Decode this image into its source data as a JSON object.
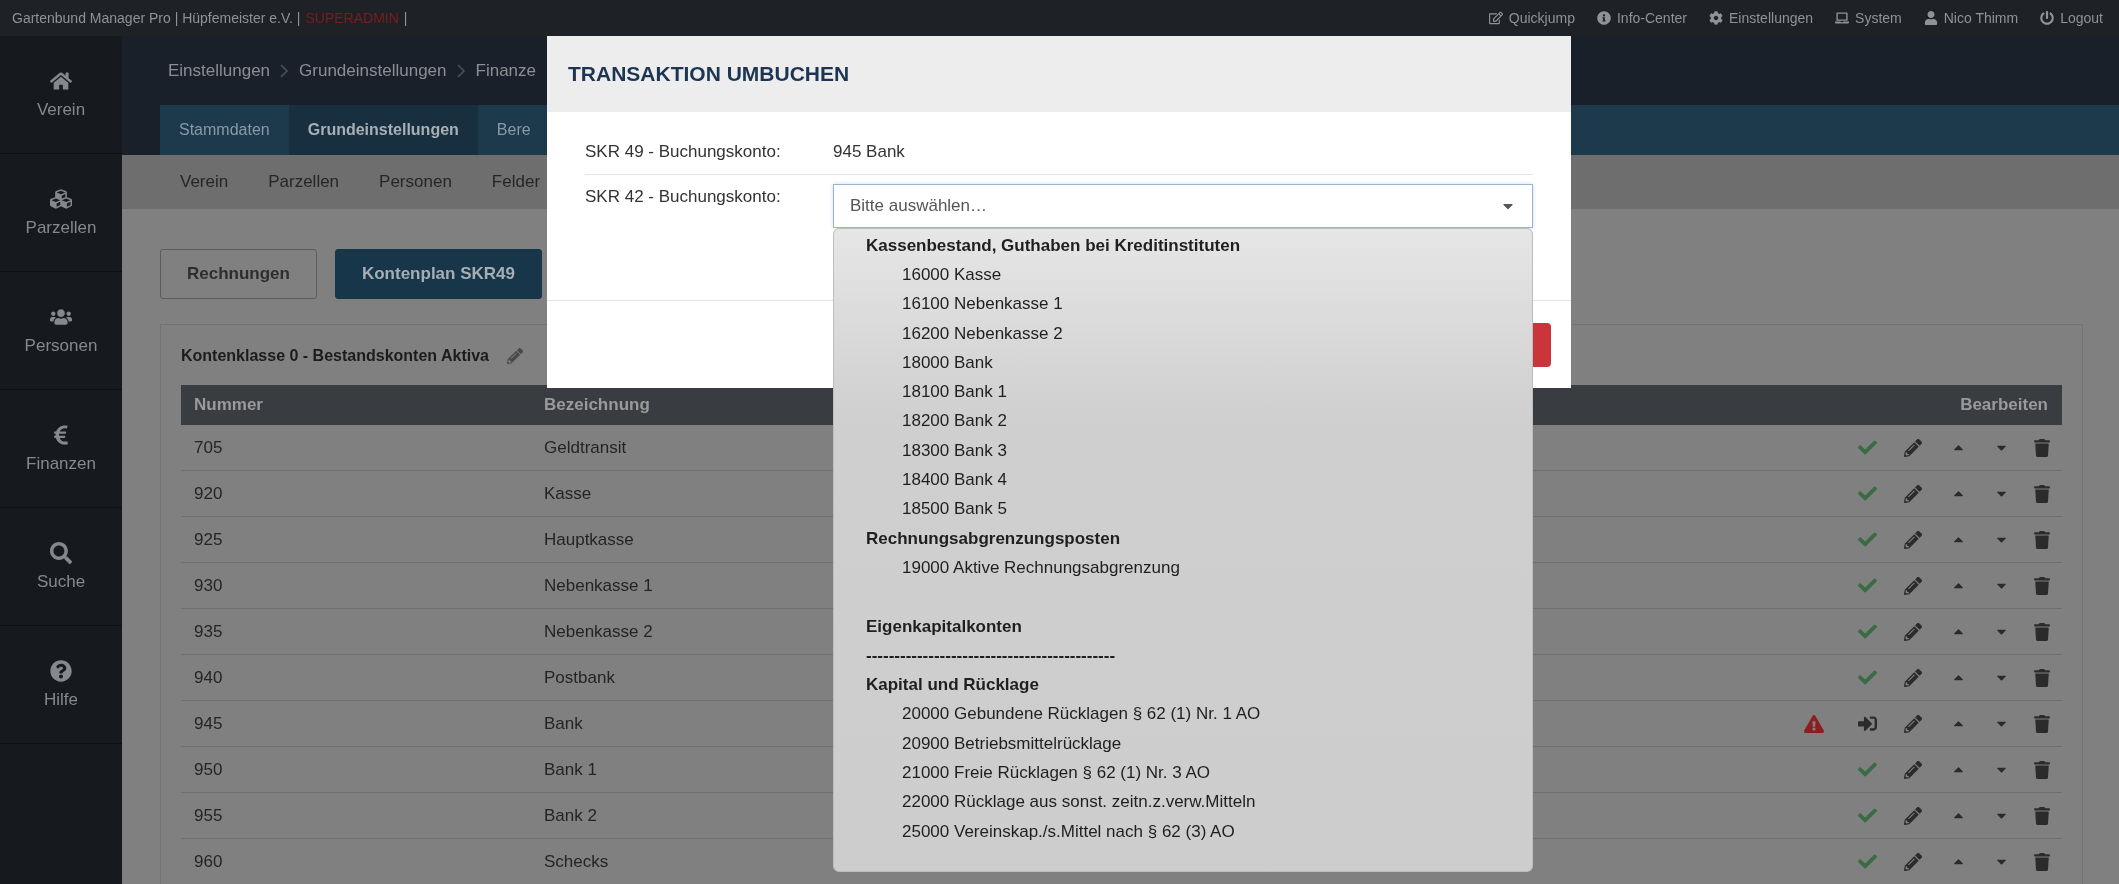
{
  "top_bar": {
    "app_title": "Gartenbund Manager Pro | Hüpfemeister e.V. |",
    "role": "SUPERADMIN",
    "separator": "|",
    "links": [
      "Quickjump",
      "Info-Center",
      "Einstellungen",
      "System",
      "Nico Thimm",
      "Logout"
    ]
  },
  "sidebar": {
    "items": [
      {
        "label": "Verein"
      },
      {
        "label": "Parzellen"
      },
      {
        "label": "Personen"
      },
      {
        "label": "Finanzen"
      },
      {
        "label": "Suche"
      },
      {
        "label": "Hilfe"
      }
    ]
  },
  "breadcrumb": [
    "Einstellungen",
    "Grundeinstellungen",
    "Finanze"
  ],
  "tabs": [
    {
      "label": "Stammdaten",
      "selected": false
    },
    {
      "label": "Grundeinstellungen",
      "selected": true
    },
    {
      "label": "Bere",
      "selected": false
    }
  ],
  "subnav": [
    "Verein",
    "Parzellen",
    "Personen",
    "Felder"
  ],
  "buttons": [
    {
      "label": "Rechnungen",
      "selected": false
    },
    {
      "label": "Kontenplan SKR49",
      "selected": true
    }
  ],
  "card": {
    "title": "Kontenklasse 0 - Bestandskonten Aktiva",
    "table": {
      "columns": [
        "Nummer",
        "Bezeichnung",
        "Bearbeiten"
      ],
      "rows": [
        {
          "number": "705",
          "name": "Geldtransit",
          "kind": "ok"
        },
        {
          "number": "920",
          "name": "Kasse",
          "kind": "ok"
        },
        {
          "number": "925",
          "name": "Hauptkasse",
          "kind": "ok"
        },
        {
          "number": "930",
          "name": "Nebenkasse 1",
          "kind": "ok"
        },
        {
          "number": "935",
          "name": "Nebenkasse 2",
          "kind": "ok"
        },
        {
          "number": "940",
          "name": "Postbank",
          "kind": "ok"
        },
        {
          "number": "945",
          "name": "Bank",
          "kind": "warning"
        },
        {
          "number": "950",
          "name": "Bank 1",
          "kind": "ok"
        },
        {
          "number": "955",
          "name": "Bank 2",
          "kind": "ok"
        },
        {
          "number": "960",
          "name": "Schecks",
          "kind": "ok"
        }
      ]
    }
  },
  "modal": {
    "title": "TRANSAKTION UMBUCHEN",
    "fields": [
      {
        "label": "SKR 49 - Buchungskonto:",
        "value": "945 Bank"
      },
      {
        "label": "SKR 42 - Buchungskonto:",
        "placeholder": "Bitte auswählen…"
      }
    ],
    "dropdown": [
      {
        "kind": "group",
        "label": "Kassenbestand, Guthaben bei Kreditinstituten",
        "children": [
          "16000 Kasse",
          "16100 Nebenkasse 1",
          "16200 Nebenkasse 2",
          "18000 Bank",
          "18100 Bank 1",
          "18200 Bank 2",
          "18300 Bank 3",
          "18400 Bank 4",
          "18500 Bank 5"
        ]
      },
      {
        "kind": "group",
        "label": "Rechnungsabgrenzungsposten",
        "children": [
          "19000 Aktive Rechnungsabgrenzung"
        ]
      },
      {
        "kind": "spacer"
      },
      {
        "kind": "group",
        "label": "Eigenkapitalkonten"
      },
      {
        "kind": "group",
        "label": "--------------------------------------------"
      },
      {
        "kind": "group",
        "label": "Kapital und Rücklage",
        "children": [
          "20000 Gebundene Rücklagen § 62 (1) Nr. 1 AO",
          "20900 Betriebsmittelrücklage",
          "21000 Freie Rücklagen § 62 (1) Nr. 3 AO",
          "22000 Rücklage aus sonst. zeitn.z.verw.Mitteln",
          "25000 Vereinskap./s.Mittel nach § 62 (3) AO"
        ]
      }
    ]
  }
}
